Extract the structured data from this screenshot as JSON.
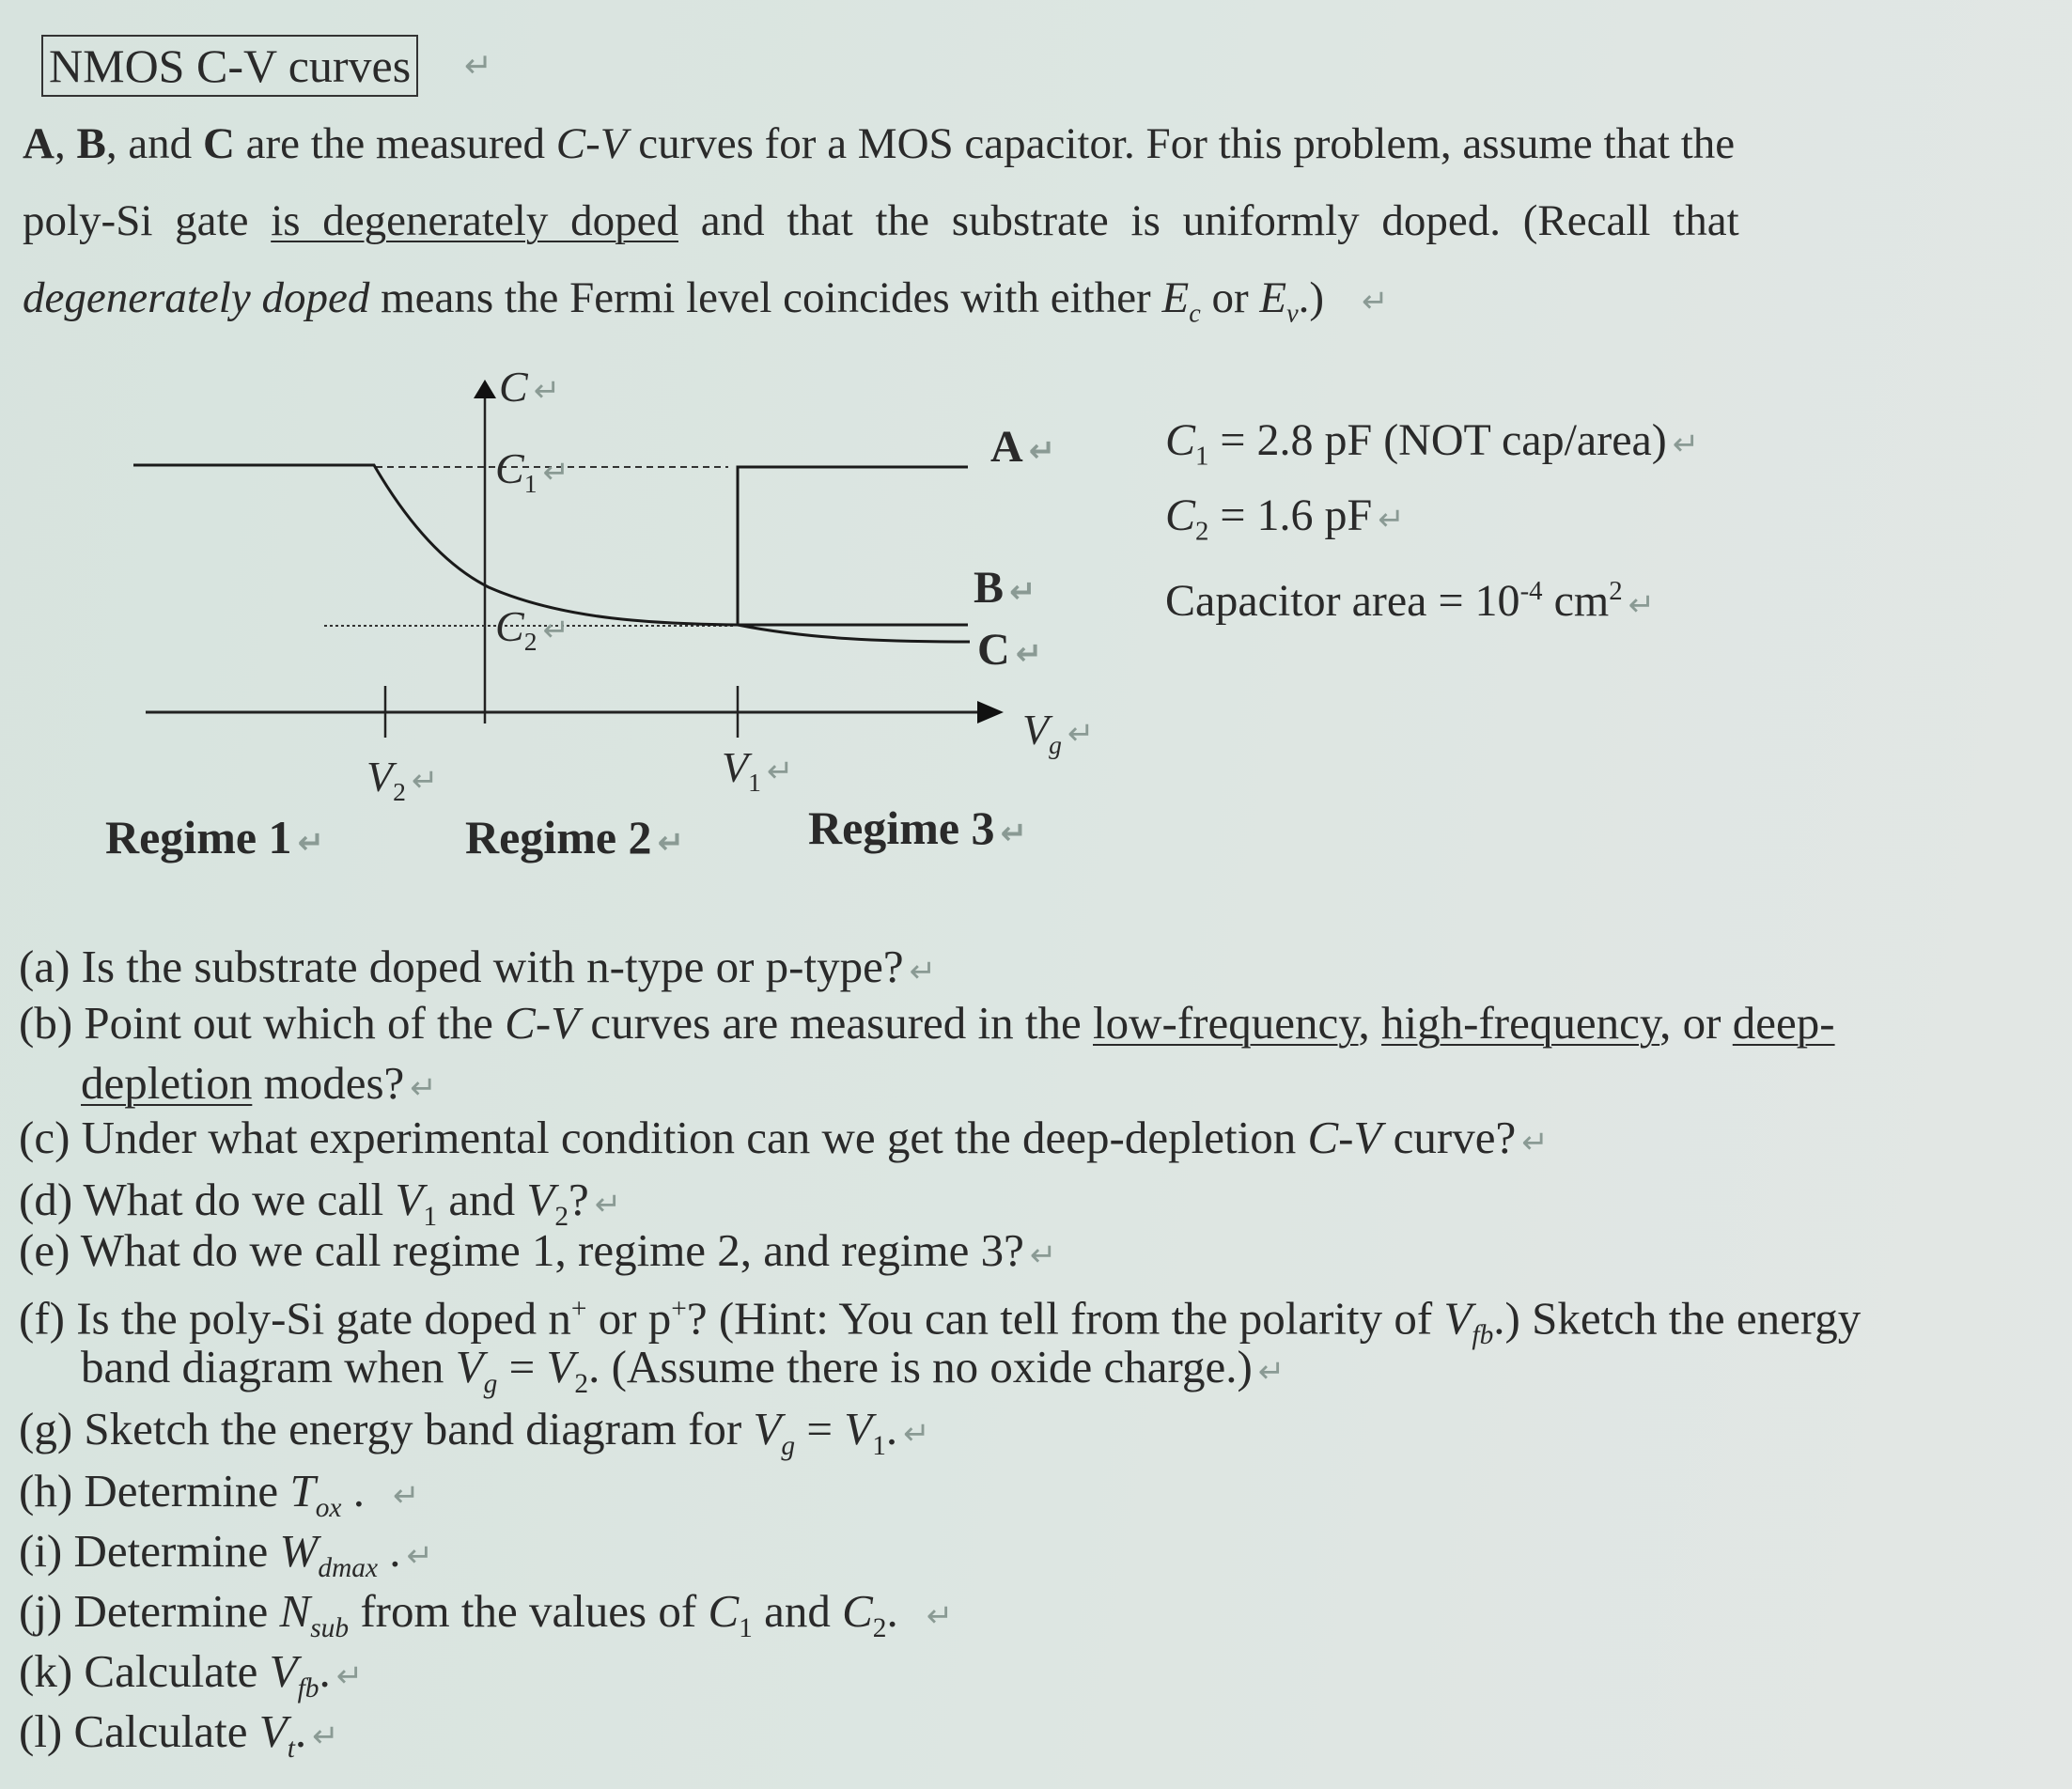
{
  "title": "NMOS C-V curves",
  "intro": {
    "line1_a": "A",
    "line1_b": "B",
    "line1_c": "C",
    "line1_rest1": ", ",
    "line1_rest2": ", and ",
    "line1_rest3": " are the measured ",
    "cv": "C-V",
    "line1_rest4": " curves for a MOS capacitor. For this problem, assume that the",
    "line2_a": "poly-Si gate ",
    "line2_underlined": "is degenerately doped",
    "line2_b": " and that the substrate is uniformly doped. (Recall that",
    "line3_italic": "degenerately doped",
    "line3_b": " means the Fermi level coincides with either ",
    "ec": "E",
    "ec_sub": "c",
    "or": " or ",
    "ev": "E",
    "ev_sub": "v",
    "line3_end": ".)"
  },
  "diagram": {
    "y_axis_label": "C",
    "x_axis_label": "V",
    "x_axis_sub": "g",
    "c1_label": "C",
    "c1_sub": "1",
    "c2_label": "C",
    "c2_sub": "2",
    "v1_label": "V",
    "v1_sub": "1",
    "v2_label": "V",
    "v2_sub": "2",
    "curve_labels": [
      "A",
      "B",
      "C"
    ],
    "regimes": [
      "Regime 1",
      "Regime 2",
      "Regime 3"
    ]
  },
  "given": {
    "c1": "C",
    "c1_sub": "1",
    "c1_value": " = 2.8 pF (NOT cap/area)",
    "c2": "C",
    "c2_sub": "2",
    "c2_value": " = 1.6 pF",
    "area_text": "Capacitor area = 10",
    "area_exp": "-4",
    "area_unit": " cm",
    "area_unit_exp": "2"
  },
  "questions": {
    "a": "(a) Is the substrate doped with n-type or p-type?",
    "b_1": "(b) Point out which of the ",
    "b_cv": "C-V",
    "b_2": " curves are measured in the ",
    "b_lf": "low-frequency",
    "b_sep1": ", ",
    "b_hf": "high-frequency",
    "b_sep2": ", or ",
    "b_dd1": "deep-",
    "b_dd2": "depletion",
    "b_3": " modes?",
    "c_1": "(c) Under what experimental condition can we get the deep-depletion ",
    "c_cv": "C-V",
    "c_2": " curve?",
    "d_1": "(d) What do we call ",
    "d_v": "V",
    "d_s1": "1",
    "d_and": " and ",
    "d_s2": "2",
    "d_end": "?",
    "e": "(e) What do we call regime 1, regime 2, and regime 3?",
    "f_1": "(f) Is the poly-Si gate doped n",
    "f_plus": "+",
    "f_or": " or p",
    "f_2": "? (Hint: You can tell from the polarity of ",
    "f_vfb": "V",
    "f_fb": "fb",
    "f_3": ".) Sketch the energy",
    "f_4": "band diagram when ",
    "f_vg": "V",
    "f_g": "g",
    "f_eq": " = ",
    "f_v2": "V",
    "f_2sub": "2",
    "f_5": ". (Assume there is no oxide charge.)",
    "g_1": "(g) Sketch the energy band diagram for ",
    "g_eq": " = ",
    "g_end": ".",
    "h_1": "(h) Determine ",
    "h_t": "T",
    "h_sub": "ox",
    "h_end": " .",
    "i_1": "(i) Determine ",
    "i_w": "W",
    "i_sub": "dmax",
    "i_end": " .",
    "j_1": "(j) Determine ",
    "j_n": "N",
    "j_sub": "sub",
    "j_2": " from the values of ",
    "j_c": "C",
    "j_and": " and ",
    "j_end": ".",
    "k_1": "(k) Calculate ",
    "k_v": "V",
    "k_sub": "fb",
    "k_end": ".",
    "l_1": "(l) Calculate ",
    "l_v": "V",
    "l_sub": "t",
    "l_end": "."
  },
  "return_mark": "↵"
}
